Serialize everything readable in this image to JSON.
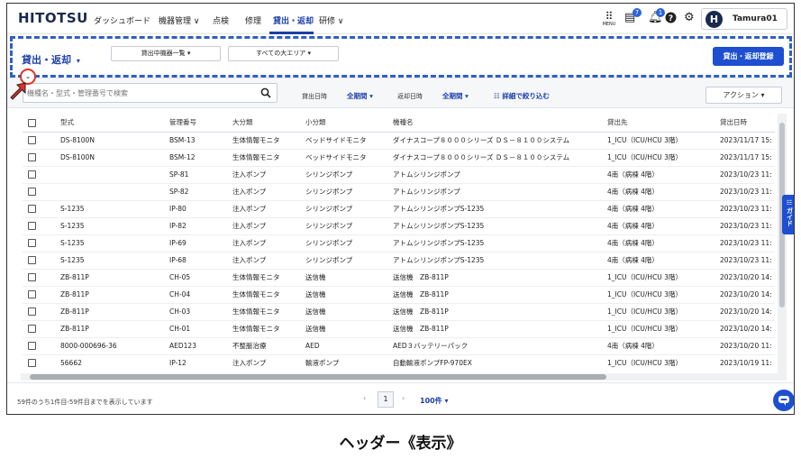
{
  "nav": {
    "logo": "HITOTSU",
    "items": [
      {
        "label": "ダッシュボード"
      },
      {
        "label": "機器管理 ∨"
      },
      {
        "label": "点検"
      },
      {
        "label": "修理"
      },
      {
        "label": "貸出・返却"
      },
      {
        "label": "研修 ∨"
      }
    ],
    "menu_label": "MENU",
    "notification_badges": [
      "7",
      "1"
    ],
    "user": {
      "initial": "H",
      "name": "Tamura01"
    }
  },
  "header": {
    "title": "貸出・返却",
    "dropdown1": "貸出中機器一覧",
    "dropdown2": "すべての大エリア",
    "primary_button": "貸出・返却登録",
    "collapse_icon": "chevron-down-icon"
  },
  "filters": {
    "search_placeholder": "機種名・型式・管理番号で検索",
    "lend_date_label": "貸出日時",
    "lend_date_value": "全期間",
    "return_date_label": "返却日時",
    "return_date_value": "全期間",
    "detail_filter": "詳細で絞り込む",
    "action_button": "アクション"
  },
  "table": {
    "headers": [
      "型式",
      "管理番号",
      "大分類",
      "小分類",
      "機種名",
      "貸出先",
      "貸出日時"
    ],
    "rows": [
      [
        "DS-8100N",
        "BSM-13",
        "生体情報モニタ",
        "ベッドサイドモニタ",
        "ダイナスコープ８０００シリーズ ＤＳ－８１００システム",
        "1_ICU（ICU/HCU 3階）",
        "2023/11/17 15:"
      ],
      [
        "DS-8100N",
        "BSM-12",
        "生体情報モニタ",
        "ベッドサイドモニタ",
        "ダイナスコープ８０００シリーズ ＤＳ－８１００システム",
        "1_ICU（ICU/HCU 3階）",
        "2023/11/17 15:"
      ],
      [
        "",
        "SP-81",
        "注入ポンプ",
        "シリンジポンプ",
        "アトムシリンジポンプ",
        "4南（病棟 4階）",
        "2023/10/23 11:"
      ],
      [
        "",
        "SP-82",
        "注入ポンプ",
        "シリンジポンプ",
        "アトムシリンジポンプ",
        "4南（病棟 4階）",
        "2023/10/23 11:"
      ],
      [
        "S-1235",
        "IP-80",
        "注入ポンプ",
        "シリンジポンプ",
        "アトムシリンジポンプS-1235",
        "4南（病棟 4階）",
        "2023/10/23 11:"
      ],
      [
        "S-1235",
        "IP-82",
        "注入ポンプ",
        "シリンジポンプ",
        "アトムシリンジポンプS-1235",
        "4南（病棟 4階）",
        "2023/10/23 11:"
      ],
      [
        "S-1235",
        "IP-69",
        "注入ポンプ",
        "シリンジポンプ",
        "アトムシリンジポンプS-1235",
        "4南（病棟 4階）",
        "2023/10/23 11:"
      ],
      [
        "S-1235",
        "IP-68",
        "注入ポンプ",
        "シリンジポンプ",
        "アトムシリンジポンプS-1235",
        "4南（病棟 4階）",
        "2023/10/23 11:"
      ],
      [
        "ZB-811P",
        "CH-05",
        "生体情報モニタ",
        "送信機",
        "送信機　ZB-811P",
        "1_ICU（ICU/HCU 3階）",
        "2023/10/20 14:"
      ],
      [
        "ZB-811P",
        "CH-04",
        "生体情報モニタ",
        "送信機",
        "送信機　ZB-811P",
        "1_ICU（ICU/HCU 3階）",
        "2023/10/20 14:"
      ],
      [
        "ZB-811P",
        "CH-03",
        "生体情報モニタ",
        "送信機",
        "送信機　ZB-811P",
        "1_ICU（ICU/HCU 3階）",
        "2023/10/20 14:"
      ],
      [
        "ZB-811P",
        "CH-01",
        "生体情報モニタ",
        "送信機",
        "送信機　ZB-811P",
        "1_ICU（ICU/HCU 3階）",
        "2023/10/20 14:"
      ],
      [
        "8000-000696-36",
        "AED123",
        "不整脈治療",
        "AED",
        "AED３バッテリーパック",
        "4南（病棟 4階）",
        "2023/10/20 11:"
      ],
      [
        "56662",
        "IP-12",
        "注入ポンプ",
        "輸液ポンプ",
        "自動輸液ポンプFP-970EX",
        "1_ICU（ICU/HCU 3階）",
        "2023/10/19 11:"
      ]
    ]
  },
  "guide_tab": "ガイド",
  "footer": {
    "summary": "59件のうち1件目-59件目までを表示しています",
    "prev": "‹",
    "page": "1",
    "next": "›",
    "per_page": "100件"
  },
  "caption": "ヘッダー《表示》",
  "colors": {
    "accent": "#1d4fd0",
    "highlight": "#2f5fc4",
    "marker": "#e53020"
  }
}
